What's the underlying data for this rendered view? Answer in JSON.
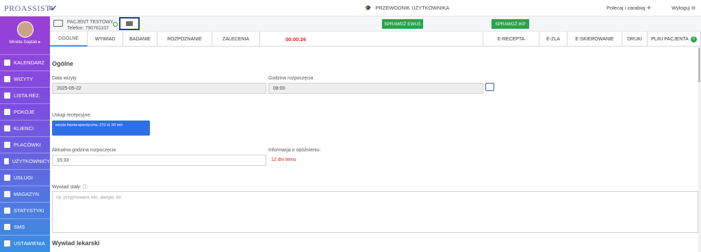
{
  "header": {
    "logo": "PROASSIST",
    "guide": "PRZEWODNIK UŻYTKOWNIKA",
    "refer": "Polecaj i zarabiaj",
    "logout": "Wyloguj"
  },
  "user": {
    "name": "Mirella Sajdak ▸"
  },
  "sidebar": {
    "items": [
      {
        "label": "KALENDARZ",
        "icon": "calendar-icon"
      },
      {
        "label": "WIZYTY",
        "icon": "list-icon"
      },
      {
        "label": "LISTA REZ.",
        "icon": "document-icon"
      },
      {
        "label": "POKOJE",
        "icon": "room-icon"
      },
      {
        "label": "KLIENCI",
        "icon": "clients-icon"
      },
      {
        "label": "PLACÓWKI",
        "icon": "building-icon"
      },
      {
        "label": "UŻYTKOWNICY",
        "icon": "user-icon"
      },
      {
        "label": "USŁUGI",
        "icon": "grid-icon"
      },
      {
        "label": "MAGAZYN",
        "icon": "box-icon"
      },
      {
        "label": "STATYSTYKI",
        "icon": "chart-icon"
      },
      {
        "label": "SMS",
        "icon": "sms-icon"
      },
      {
        "label": "USTAWIENIA",
        "icon": "tools-icon"
      }
    ]
  },
  "patient": {
    "name": "PACJENT TESTOWY",
    "phone": "Telefon: 790761107"
  },
  "buttons": {
    "ewus": "SPRAWDŹ EWUŚ",
    "ikp": "SPRAWDŹ IKP"
  },
  "tabs": [
    {
      "label": "OGÓLNE"
    },
    {
      "label": "WYWIAD"
    },
    {
      "label": "BADANIE"
    },
    {
      "label": "ROZPOZNANIE"
    },
    {
      "label": "ZALECENIA"
    }
  ],
  "timer": "00:00:26",
  "rtabs": [
    {
      "label": "E-RECEPTA"
    },
    {
      "label": "E-ZLA"
    },
    {
      "label": "E-SKIEROWANIE"
    },
    {
      "label": "DRUKI"
    },
    {
      "label": "PLIKI PACJENTA"
    }
  ],
  "files_count": "0",
  "form": {
    "section": "Ogólne",
    "date_label": "Data wizyty",
    "date": "2025-05-22",
    "start_label": "Godzina rozpoczęcia",
    "start": "08:00",
    "services_label": "Usługi recepcyjne:",
    "service": "wizyta fizjoterapeutyczna, 270 zł, 60 min",
    "actual_label": "Aktualna godzina rozpoczęcia",
    "actual": "15:33",
    "delay_label": "Informacja o opóźnieniu:",
    "delay": "12 dni temu",
    "history_label": "Wywiad stały:",
    "history_placeholder": "np. przyjmowane leki, alergie, itd.",
    "medical": "Wywiad lekarski"
  }
}
